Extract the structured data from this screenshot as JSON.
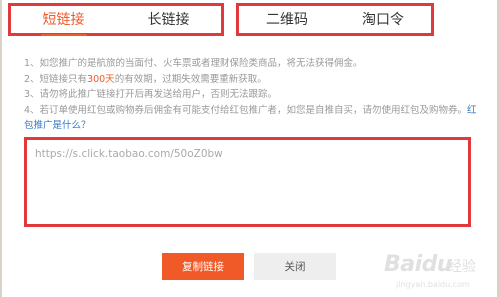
{
  "tabs": {
    "short_link": "短链接",
    "long_link": "长链接",
    "qr_code": "二维码",
    "taokouling": "淘口令"
  },
  "notes": {
    "line1": "1、如您推广的是航旅的当面付、火车票或者理财保险类商品，将无法获得佣金。",
    "line2_prefix": "2、短链接只有",
    "line2_days": "300天",
    "line2_suffix": "的有效期，过期失效需要重新获取。",
    "line3": "3、请勿将此推广链接打开后再发送给用户，否则无法跟踪。",
    "line4": "4、若订单使用红包或购物券后佣金有可能支付给红包推广者，如您是自推自买，请勿使用红包及购物券。",
    "red_packet_link": "红包推广是什么？"
  },
  "link_box": {
    "value": "https://s.click.taobao.com/50oZ0bw"
  },
  "buttons": {
    "copy": "复制链接",
    "close": "关闭"
  },
  "watermark": {
    "brand": "Baidu",
    "sub": "经验",
    "url": "jingyan.baidu.com"
  },
  "colors": {
    "accent": "#f05a28",
    "highlight_border": "#e0393b",
    "link": "#3478c2"
  }
}
